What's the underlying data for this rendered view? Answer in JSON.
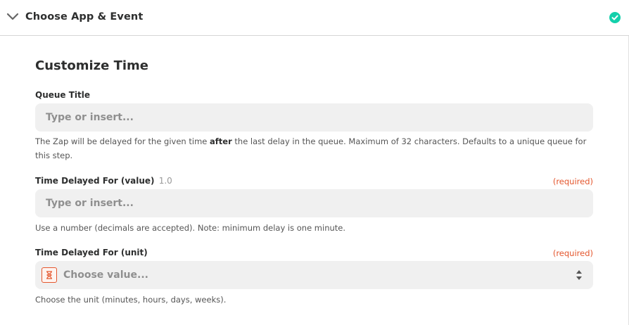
{
  "header": {
    "title": "Choose App & Event",
    "chevron_icon": "chevron-down-icon",
    "status_icon": "check-circle-icon",
    "status_color": "#13d0ab"
  },
  "form": {
    "title": "Customize Time",
    "queue_title": {
      "label": "Queue Title",
      "placeholder": "Type or insert...",
      "help_before": "The Zap will be delayed for the given time ",
      "help_bold": "after",
      "help_after": " the last delay in the queue. Maximum of 32 characters. Defaults to a unique queue for this step."
    },
    "delay_value": {
      "label": "Time Delayed For (value)",
      "version": "1.0",
      "required": "(required)",
      "placeholder": "Type or insert...",
      "help": "Use a number (decimals are accepted). Note: minimum delay is one minute."
    },
    "delay_unit": {
      "label": "Time Delayed For (unit)",
      "required": "(required)",
      "placeholder": "Choose value...",
      "icon": "hourglass-icon",
      "dropdown_icon": "sort-arrows-icon",
      "help": "Choose the unit (minutes, hours, days, weeks)."
    }
  },
  "colors": {
    "required": "#e4572e",
    "input_bg": "#f0f0f0"
  }
}
